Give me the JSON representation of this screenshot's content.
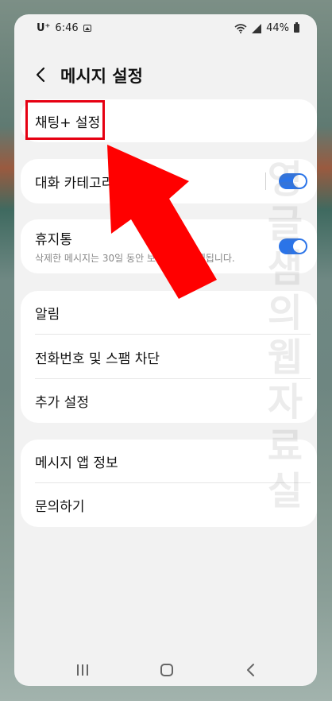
{
  "status": {
    "carrier": "U⁺",
    "time": "6:46",
    "battery": "44%"
  },
  "header": {
    "title": "메시지 설정"
  },
  "items": {
    "chat_settings": "채팅+ 설정",
    "conversation_categories": "대화 카테고리",
    "trash": "휴지통",
    "trash_desc": "삭제한 메시지는 30일 동안 보관된 후 삭제됩니다.",
    "notifications": "알림",
    "block": "전화번호 및 스팸 차단",
    "more": "추가 설정",
    "about": "메시지 앱 정보",
    "contact": "문의하기"
  },
  "watermark": [
    "영",
    "글",
    "샘",
    "의",
    "웹",
    "자",
    "료",
    "실"
  ],
  "colors": {
    "toggle_on": "#2b74e8",
    "highlight": "#e60012",
    "arrow": "#ff0000"
  },
  "icons": {
    "back": "chevron-left-icon",
    "recent": "recent-apps-icon",
    "home": "home-icon",
    "nav_back": "nav-back-icon"
  }
}
